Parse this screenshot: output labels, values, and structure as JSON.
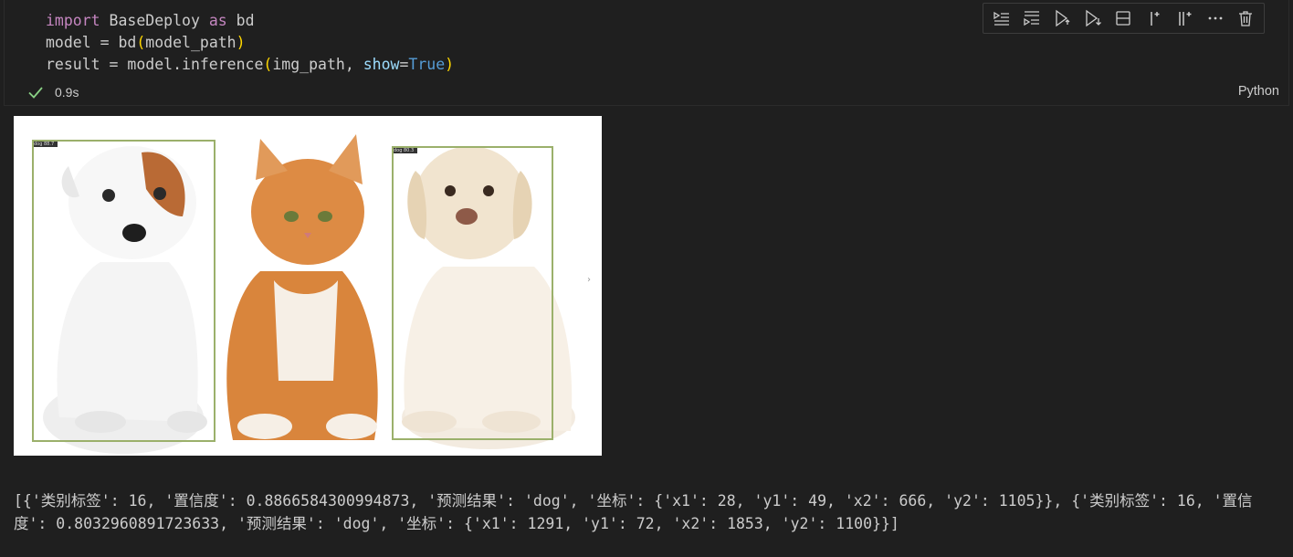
{
  "code": {
    "line1": {
      "kw1": "import",
      "mod": " BaseDeploy ",
      "kw2": "as",
      "alias": " bd"
    },
    "line2": {
      "lhs": "model = bd",
      "open": "(",
      "arg": "model_path",
      "close": ")"
    },
    "line3": {
      "lhs": "result = model.inference",
      "open": "(",
      "arg1": "img_path, ",
      "param": "show",
      "eq": "=",
      "val": "True",
      "close": ")"
    }
  },
  "status": {
    "time": "0.9s",
    "language": "Python"
  },
  "toolbar": [
    "execute-above-icon",
    "execute-below-icon",
    "run-cell-icon",
    "run-below-icon",
    "split-cell-icon",
    "add-cell-above-icon",
    "add-cell-below-icon",
    "more-icon",
    "delete-icon"
  ],
  "output": {
    "image": {
      "boxes": [
        {
          "label": "dog 88.7"
        },
        {
          "label": "dog 80.3"
        }
      ]
    },
    "result_text": "[{'类别标签': 16, '置信度': 0.8866584300994873, '预测结果': 'dog', '坐标': {'x1': 28, 'y1': 49, 'x2': 666, 'y2': 1105}}, {'类别标签': 16, '置信度': 0.8032960891723633, '预测结果': 'dog', '坐标': {'x1': 1291, 'y1': 72, 'x2': 1853, 'y2': 1100}}]"
  },
  "colors": {
    "background": "#1f1f1f",
    "success": "#89d185",
    "bbox": "#9bb06b"
  }
}
